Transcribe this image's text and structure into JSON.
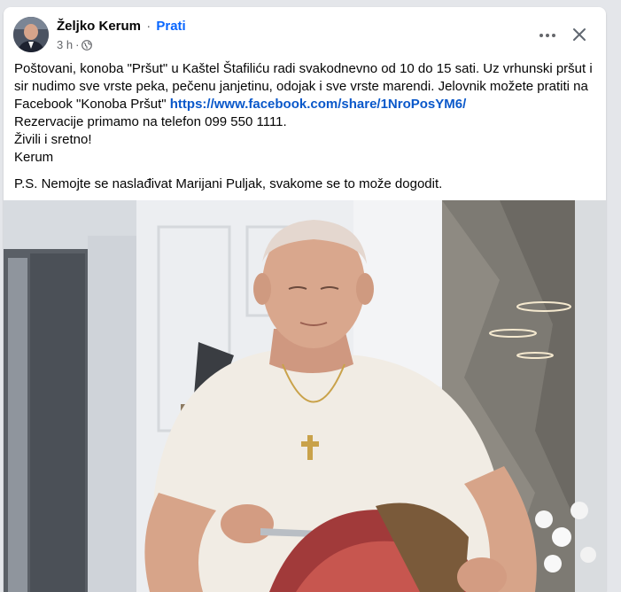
{
  "post": {
    "author": {
      "name": "Željko Kerum",
      "separator": "·",
      "follow_label": "Prati"
    },
    "meta": {
      "time": "3 h",
      "dot": "·",
      "audience_icon": "globe-icon"
    },
    "actions": {
      "more_icon": "more-options-icon",
      "close_icon": "close-icon"
    },
    "text": {
      "line1": "Poštovani, konoba \"Pršut\" u Kaštel Štafiliću radi svakodnevno od 10 do 15 sati. Uz vrhunski pršut i",
      "line2": "sir nudimo  sve vrste peka, pečenu janjetinu, odojak i sve vrste marendi. Jelovnik možete pratiti na",
      "line3_prefix": "Facebook \"Konoba Pršut\" ",
      "link": "https://www.facebook.com/share/1NroPosYM6/",
      "line4": " Rezervacije primamo na telefon 099 550 1111.",
      "line5": "Živili i sretno!",
      "line6": "Kerum",
      "ps": "P.S. Nemojte se naslađivat Marijani Puljak, svakome se to može dogodit."
    },
    "photo": {
      "subject": "post-photo"
    },
    "colors": {
      "link": "#0a58ca",
      "follow": "#0866ff",
      "meta": "#65676b",
      "text": "#050505"
    }
  }
}
